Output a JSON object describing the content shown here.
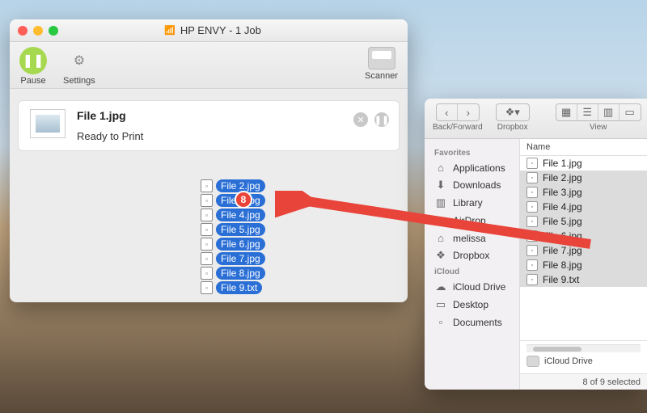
{
  "print_queue": {
    "title": "HP ENVY - 1 Job",
    "toolbar": {
      "pause": "Pause",
      "settings": "Settings",
      "scanner": "Scanner"
    },
    "job": {
      "filename": "File 1.jpg",
      "status": "Ready to Print"
    }
  },
  "drag": {
    "badge": "8",
    "files": [
      "File 2.jpg",
      "File 3.jpg",
      "File 4.jpg",
      "File 5.jpg",
      "File 6.jpg",
      "File 7.jpg",
      "File 8.jpg",
      "File 9.txt"
    ]
  },
  "finder": {
    "toolbar": {
      "back_forward": "Back/Forward",
      "path": "Dropbox",
      "view": "View"
    },
    "sidebar": {
      "fav_header": "Favorites",
      "items": [
        {
          "icon": "⌂",
          "label": "Applications"
        },
        {
          "icon": "⬇",
          "label": "Downloads"
        },
        {
          "icon": "▥",
          "label": "Library"
        },
        {
          "icon": "◎",
          "label": "AirDrop"
        },
        {
          "icon": "⌂",
          "label": "melissa"
        },
        {
          "icon": "❖",
          "label": "Dropbox"
        }
      ],
      "icloud_header": "iCloud",
      "icloud_items": [
        {
          "icon": "☁",
          "label": "iCloud Drive"
        },
        {
          "icon": "▭",
          "label": "Desktop"
        },
        {
          "icon": "▫",
          "label": "Documents"
        }
      ]
    },
    "list": {
      "column": "Name",
      "files": [
        {
          "name": "File 1.jpg",
          "sel": false
        },
        {
          "name": "File 2.jpg",
          "sel": true
        },
        {
          "name": "File 3.jpg",
          "sel": true
        },
        {
          "name": "File 4.jpg",
          "sel": true
        },
        {
          "name": "File 5.jpg",
          "sel": true
        },
        {
          "name": "File 6.jpg",
          "sel": true
        },
        {
          "name": "File 7.jpg",
          "sel": true
        },
        {
          "name": "File 8.jpg",
          "sel": true
        },
        {
          "name": "File 9.txt",
          "sel": true
        }
      ],
      "device": "iCloud Drive",
      "status": "8 of 9 selected"
    }
  },
  "colors": {
    "red": "#ff5f57",
    "yellow": "#febc2e",
    "green": "#28c840",
    "sel": "#2a6fd6",
    "arrow": "#e8443a"
  }
}
